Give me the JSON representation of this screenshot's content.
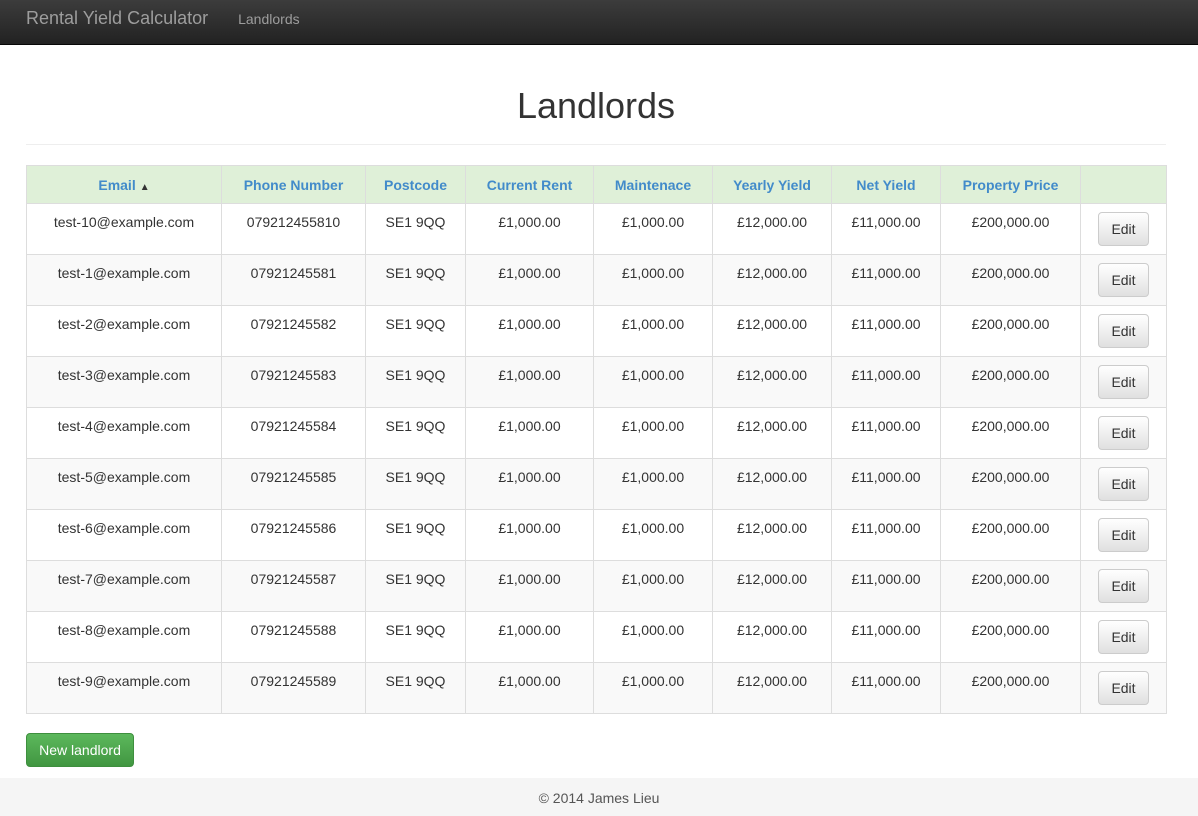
{
  "navbar": {
    "brand": "Rental Yield Calculator",
    "links": [
      {
        "label": "Landlords"
      }
    ]
  },
  "page": {
    "title": "Landlords"
  },
  "table": {
    "columns": [
      "Email",
      "Phone Number",
      "Postcode",
      "Current Rent",
      "Maintenace",
      "Yearly Yield",
      "Net Yield",
      "Property Price",
      ""
    ],
    "sort_indicator": "▲",
    "edit_label": "Edit",
    "rows": [
      [
        "test-10@example.com",
        "079212455810",
        "SE1 9QQ",
        "£1,000.00",
        "£1,000.00",
        "£12,000.00",
        "£11,000.00",
        "£200,000.00"
      ],
      [
        "test-1@example.com",
        "07921245581",
        "SE1 9QQ",
        "£1,000.00",
        "£1,000.00",
        "£12,000.00",
        "£11,000.00",
        "£200,000.00"
      ],
      [
        "test-2@example.com",
        "07921245582",
        "SE1 9QQ",
        "£1,000.00",
        "£1,000.00",
        "£12,000.00",
        "£11,000.00",
        "£200,000.00"
      ],
      [
        "test-3@example.com",
        "07921245583",
        "SE1 9QQ",
        "£1,000.00",
        "£1,000.00",
        "£12,000.00",
        "£11,000.00",
        "£200,000.00"
      ],
      [
        "test-4@example.com",
        "07921245584",
        "SE1 9QQ",
        "£1,000.00",
        "£1,000.00",
        "£12,000.00",
        "£11,000.00",
        "£200,000.00"
      ],
      [
        "test-5@example.com",
        "07921245585",
        "SE1 9QQ",
        "£1,000.00",
        "£1,000.00",
        "£12,000.00",
        "£11,000.00",
        "£200,000.00"
      ],
      [
        "test-6@example.com",
        "07921245586",
        "SE1 9QQ",
        "£1,000.00",
        "£1,000.00",
        "£12,000.00",
        "£11,000.00",
        "£200,000.00"
      ],
      [
        "test-7@example.com",
        "07921245587",
        "SE1 9QQ",
        "£1,000.00",
        "£1,000.00",
        "£12,000.00",
        "£11,000.00",
        "£200,000.00"
      ],
      [
        "test-8@example.com",
        "07921245588",
        "SE1 9QQ",
        "£1,000.00",
        "£1,000.00",
        "£12,000.00",
        "£11,000.00",
        "£200,000.00"
      ],
      [
        "test-9@example.com",
        "07921245589",
        "SE1 9QQ",
        "£1,000.00",
        "£1,000.00",
        "£12,000.00",
        "£11,000.00",
        "£200,000.00"
      ]
    ]
  },
  "actions": {
    "new_label": "New landlord"
  },
  "footer": {
    "text": "© 2014 James Lieu"
  },
  "colors": {
    "link": "#428bca",
    "header_bg": "#dff0d8",
    "success": "#5cb85c",
    "navbar": "#222222"
  }
}
